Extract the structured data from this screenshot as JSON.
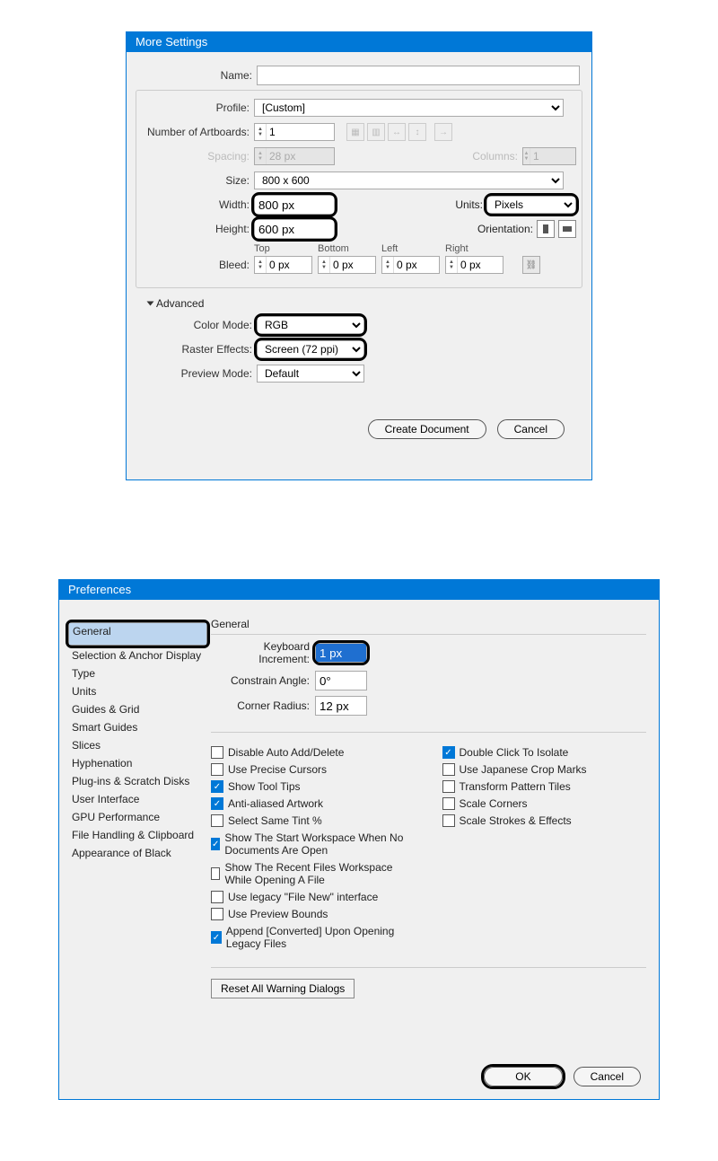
{
  "dialog1": {
    "title": "More Settings",
    "labels": {
      "name": "Name:",
      "profile": "Profile:",
      "artboards": "Number of Artboards:",
      "spacing": "Spacing:",
      "columns": "Columns:",
      "size": "Size:",
      "width": "Width:",
      "height": "Height:",
      "units": "Units:",
      "orientation": "Orientation:",
      "bleed": "Bleed:",
      "top": "Top",
      "bottom": "Bottom",
      "left": "Left",
      "right": "Right",
      "advanced": "Advanced",
      "color_mode": "Color Mode:",
      "raster_effects": "Raster Effects:",
      "preview_mode": "Preview Mode:"
    },
    "values": {
      "name": "",
      "profile": "[Custom]",
      "artboards": "1",
      "spacing": "28 px",
      "columns": "1",
      "size": "800 x 600",
      "width": "800 px",
      "height": "600 px",
      "units": "Pixels",
      "bleed_top": "0 px",
      "bleed_bottom": "0 px",
      "bleed_left": "0 px",
      "bleed_right": "0 px",
      "color_mode": "RGB",
      "raster_effects": "Screen (72 ppi)",
      "preview_mode": "Default"
    },
    "buttons": {
      "create": "Create Document",
      "cancel": "Cancel"
    }
  },
  "dialog2": {
    "title": "Preferences",
    "categories": [
      "General",
      "Selection & Anchor Display",
      "Type",
      "Units",
      "Guides & Grid",
      "Smart Guides",
      "Slices",
      "Hyphenation",
      "Plug-ins & Scratch Disks",
      "User Interface",
      "GPU Performance",
      "File Handling & Clipboard",
      "Appearance of Black"
    ],
    "panel": {
      "heading": "General",
      "labels": {
        "keyboard_increment": "Keyboard Increment:",
        "constrain_angle": "Constrain Angle:",
        "corner_radius": "Corner Radius:"
      },
      "values": {
        "keyboard_increment": "1 px",
        "constrain_angle": "0°",
        "corner_radius": "12 px"
      },
      "checks_left": [
        {
          "label": "Disable Auto Add/Delete",
          "on": false
        },
        {
          "label": "Use Precise Cursors",
          "on": false
        },
        {
          "label": "Show Tool Tips",
          "on": true
        },
        {
          "label": "Anti-aliased Artwork",
          "on": true
        },
        {
          "label": "Select Same Tint %",
          "on": false
        },
        {
          "label": "Show The Start Workspace When No Documents Are Open",
          "on": true
        },
        {
          "label": "Show The Recent Files Workspace While Opening A File",
          "on": false
        },
        {
          "label": "Use legacy \"File New\" interface",
          "on": false
        },
        {
          "label": "Use Preview Bounds",
          "on": false
        },
        {
          "label": "Append [Converted] Upon Opening Legacy Files",
          "on": true
        }
      ],
      "checks_right": [
        {
          "label": "Double Click To Isolate",
          "on": true
        },
        {
          "label": "Use Japanese Crop Marks",
          "on": false
        },
        {
          "label": "Transform Pattern Tiles",
          "on": false
        },
        {
          "label": "Scale Corners",
          "on": false
        },
        {
          "label": "Scale Strokes & Effects",
          "on": false
        }
      ],
      "reset_btn": "Reset All Warning Dialogs"
    },
    "buttons": {
      "ok": "OK",
      "cancel": "Cancel"
    }
  }
}
